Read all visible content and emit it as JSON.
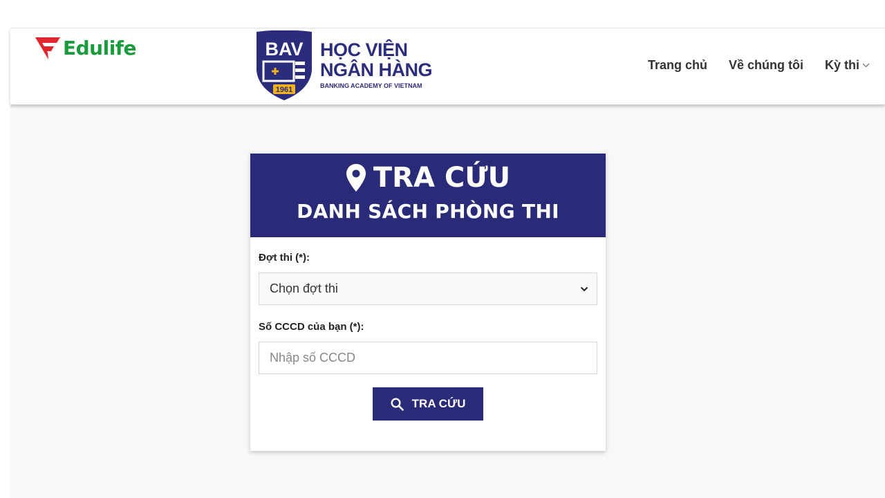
{
  "logo": {
    "brand_text": "Edulife"
  },
  "academy": {
    "abbr": "BAV",
    "year": "1961",
    "name_line1": "HỌC VIỆN",
    "name_line2": "NGÂN HÀNG",
    "name_en": "BANKING ACADEMY OF VIETNAM"
  },
  "nav": {
    "items": [
      {
        "label": "Trang chủ"
      },
      {
        "label": "Về chúng tôi"
      },
      {
        "label": "Kỳ thi",
        "has_dropdown": true
      }
    ]
  },
  "card": {
    "title": "TRA CỨU",
    "subtitle": "DANH SÁCH PHÒNG THI",
    "exam_period": {
      "label": "Đợt thi (*):",
      "selected": "Chọn đợt thi"
    },
    "id_number": {
      "label": "Số CCCD của bạn (*):",
      "placeholder": "Nhập số CCCD",
      "value": ""
    },
    "submit_label": "TRA CỨU"
  },
  "colors": {
    "primary": "#292b78",
    "brand_green": "#1a9c3e",
    "brand_red": "#e1262d"
  },
  "icons": {
    "card_title": "map-pin-icon",
    "submit": "search-icon",
    "select_arrow": "chevron-down-icon",
    "nav_dropdown": "chevron-down-icon"
  }
}
